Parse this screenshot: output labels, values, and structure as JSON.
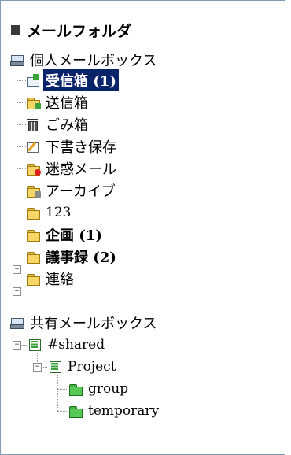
{
  "tree": {
    "header": "メールフォルダ",
    "personal_mailbox": "個人メールボックス",
    "personal_folders": [
      {
        "label": "受信箱",
        "count": "(1)",
        "icon": "inbox-icon"
      },
      {
        "label": "送信箱",
        "icon": "sent-folder-icon"
      },
      {
        "label": "ごみ箱",
        "icon": "trash-icon"
      },
      {
        "label": "下書き保存",
        "icon": "draft-icon"
      },
      {
        "label": "迷惑メール",
        "icon": "junk-folder-icon"
      },
      {
        "label": "アーカイブ",
        "icon": "archive-folder-icon"
      },
      {
        "label": "123",
        "icon": "folder-icon"
      },
      {
        "label": "企画",
        "count": "(1)",
        "icon": "folder-icon"
      },
      {
        "label": "議事録",
        "count": "(2)",
        "icon": "folder-icon"
      },
      {
        "label": "連絡",
        "icon": "folder-icon"
      }
    ],
    "shared_mailbox": "共有メールボックス",
    "shared_folders": [
      {
        "label": "#shared",
        "icon": "shared-mailbox-icon"
      },
      {
        "label": "Project",
        "icon": "shared-mailbox-icon"
      },
      {
        "label": "group",
        "icon": "green-folder-icon"
      },
      {
        "label": "temporary",
        "icon": "green-folder-icon"
      }
    ],
    "selected": "受信箱",
    "colors": {
      "selection": "#0a246a",
      "folder": "#f6d667",
      "shared_folder": "#55c855"
    }
  }
}
